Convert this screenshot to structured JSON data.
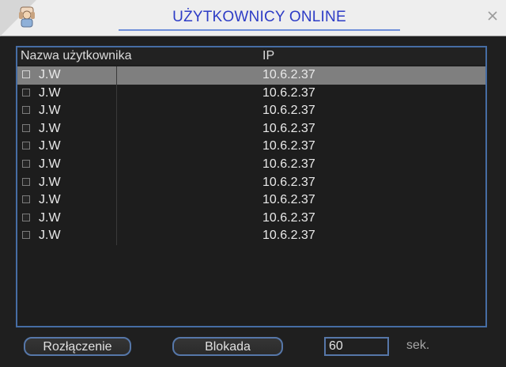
{
  "window": {
    "title": "UŻYTKOWNICY ONLINE"
  },
  "table": {
    "columns": {
      "username": "Nazwa użytkownika",
      "ip": "IP"
    },
    "rows": [
      {
        "username": "J.W",
        "ip": "10.6.2.37",
        "selected": true
      },
      {
        "username": "J.W",
        "ip": "10.6.2.37",
        "selected": false
      },
      {
        "username": "J.W",
        "ip": "10.6.2.37",
        "selected": false
      },
      {
        "username": "J.W",
        "ip": "10.6.2.37",
        "selected": false
      },
      {
        "username": "J.W",
        "ip": "10.6.2.37",
        "selected": false
      },
      {
        "username": "J.W",
        "ip": "10.6.2.37",
        "selected": false
      },
      {
        "username": "J.W",
        "ip": "10.6.2.37",
        "selected": false
      },
      {
        "username": "J.W",
        "ip": "10.6.2.37",
        "selected": false
      },
      {
        "username": "J.W",
        "ip": "10.6.2.37",
        "selected": false
      },
      {
        "username": "J.W",
        "ip": "10.6.2.37",
        "selected": false
      }
    ]
  },
  "footer": {
    "disconnect_label": "Rozłączenie",
    "block_label": "Blokada",
    "seconds_value": "60",
    "seconds_unit": "sek."
  },
  "icons": {
    "app": "person-icon",
    "close": "close-icon"
  },
  "colors": {
    "title": "#2d3cc6",
    "border": "#466da4",
    "selected_row": "#7f7f7f"
  }
}
